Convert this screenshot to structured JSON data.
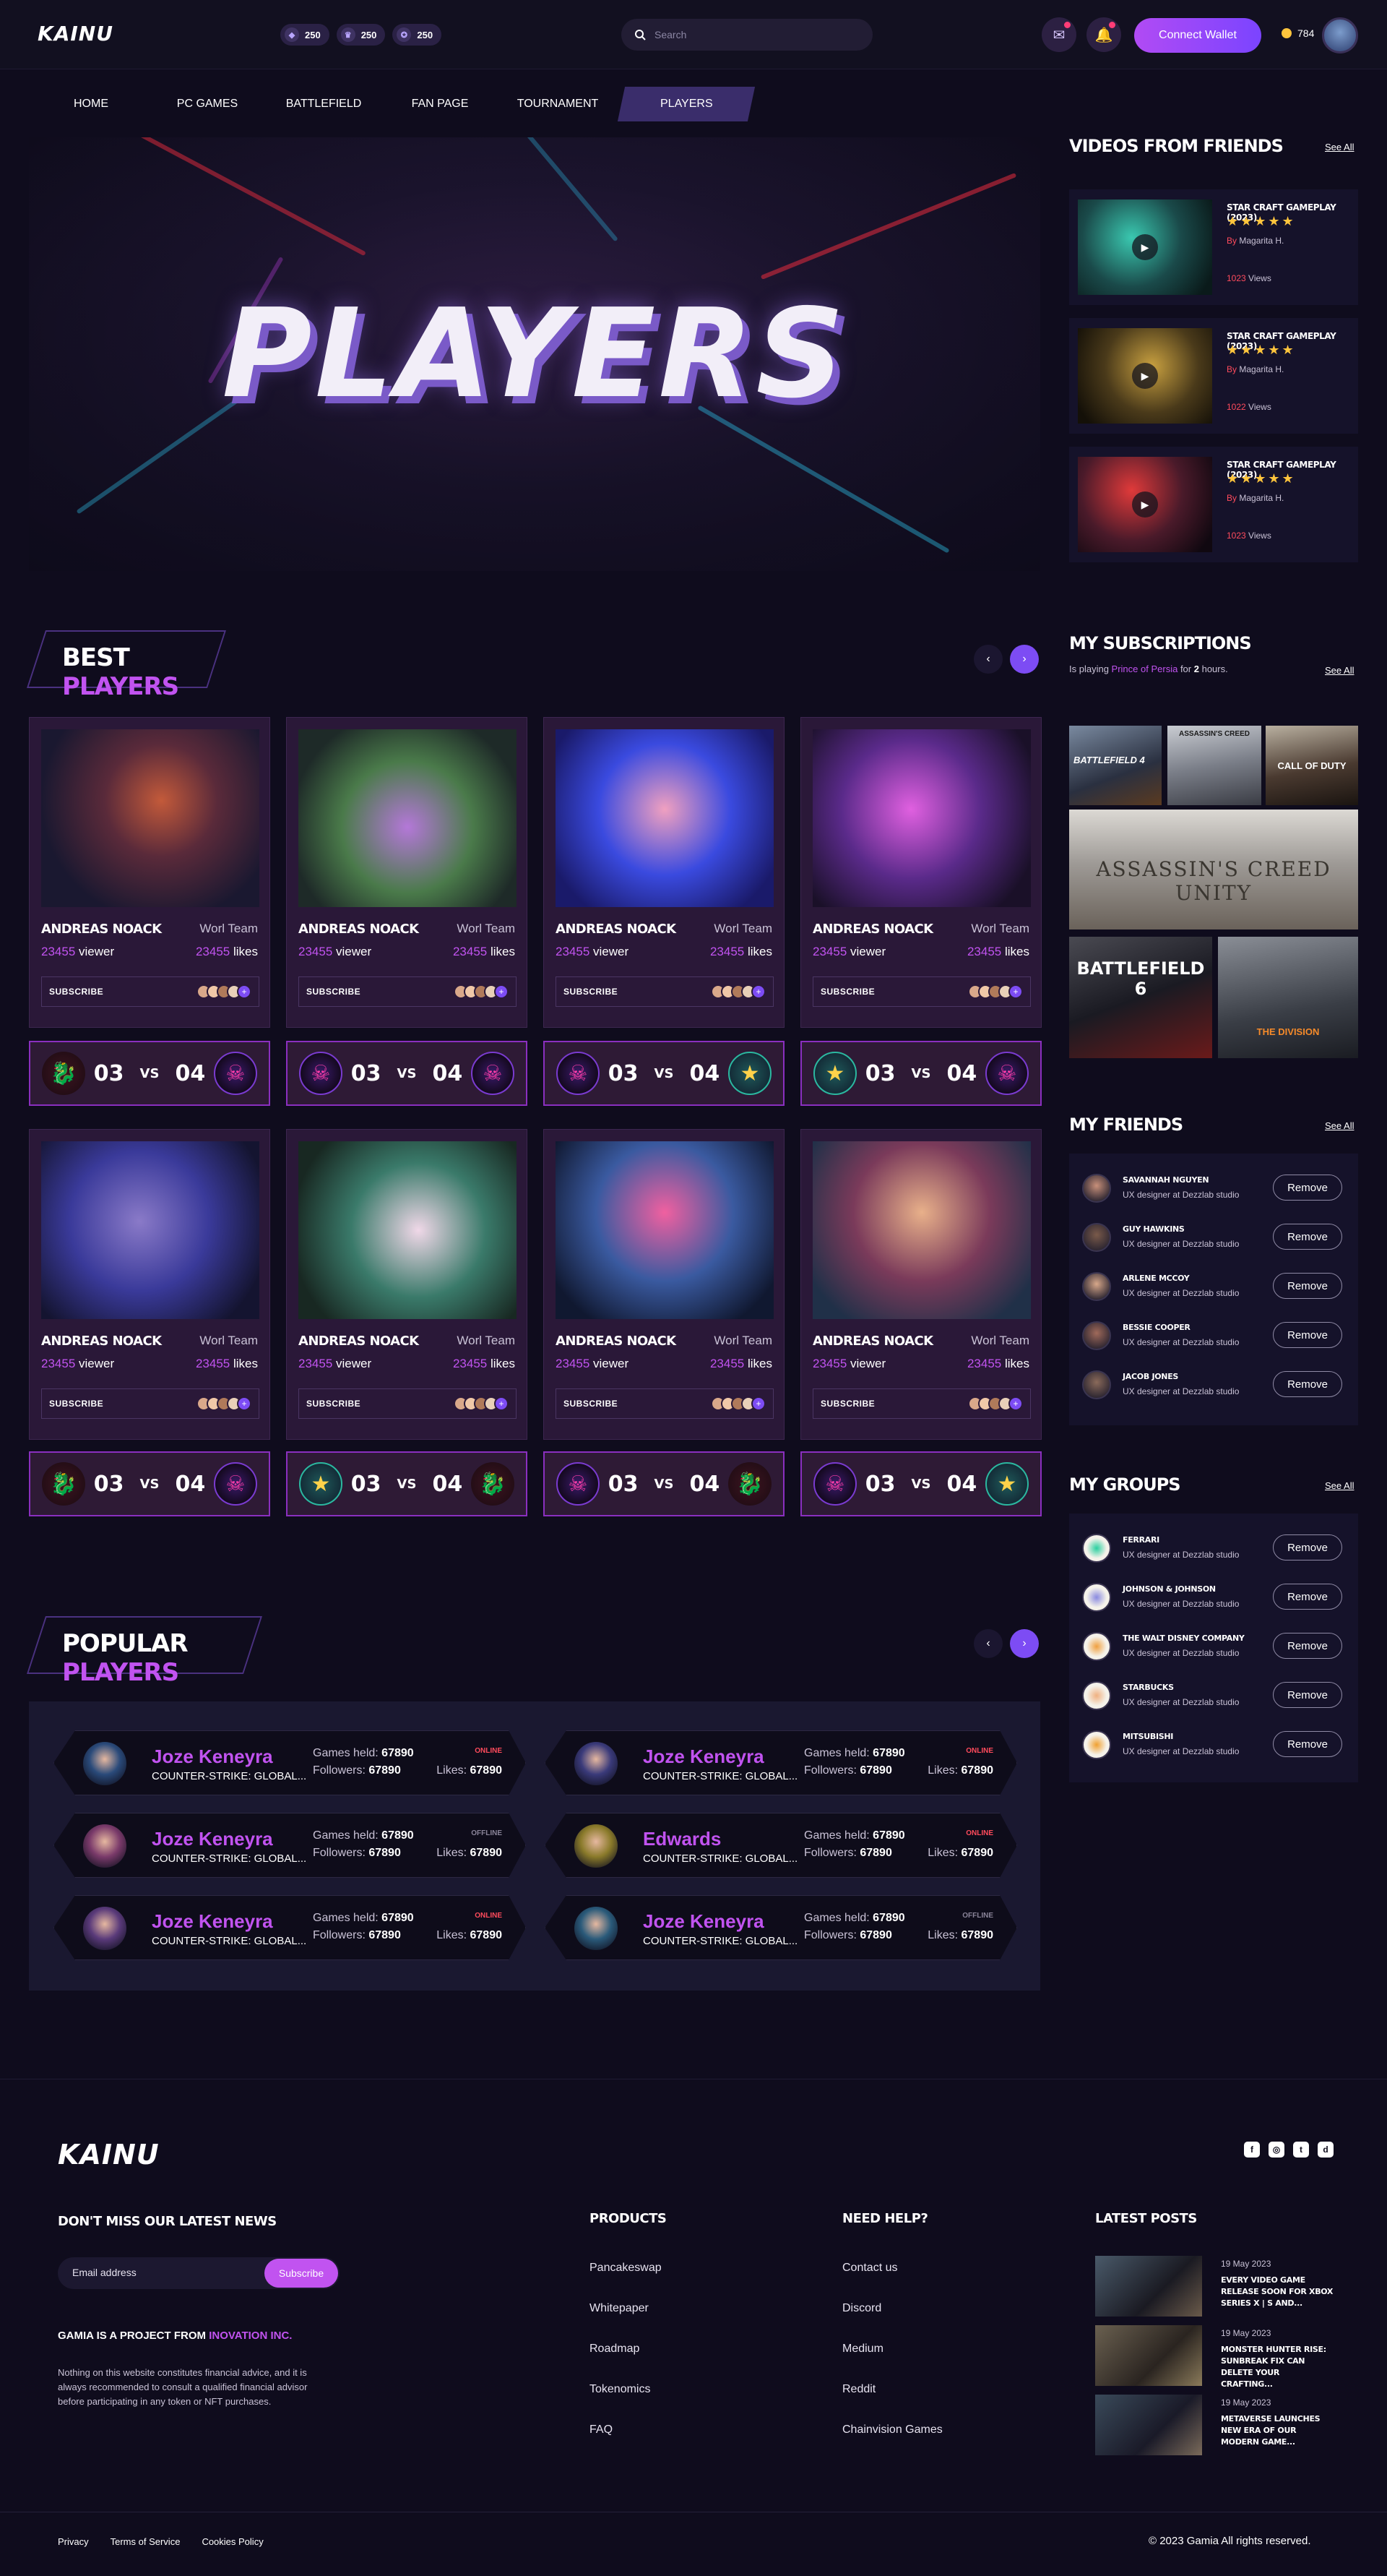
{
  "header": {
    "logo": "KAINU",
    "stats": [
      {
        "icon": "controller-icon",
        "value": "250"
      },
      {
        "icon": "trophy-icon",
        "value": "250"
      },
      {
        "icon": "medal-icon",
        "value": "250"
      }
    ],
    "search_placeholder": "Search",
    "connect_label": "Connect Wallet",
    "coins": "784"
  },
  "nav": [
    "HOME",
    "PC GAMES",
    "BATTLEFIELD",
    "FAN PAGE",
    "TOURNAMENT",
    "PLAYERS"
  ],
  "hero": {
    "title": "PLAYERS"
  },
  "best_players": {
    "title_plain": "BEST",
    "title_accent": "PLAYERS",
    "cards": [
      {
        "name": "ANDREAS NOACK",
        "team": "Worl Team",
        "viewer_num": "23455",
        "viewer_label": "viewer",
        "likes_num": "23455",
        "likes_label": "likes",
        "subscribe": "SUBSCRIBE",
        "score_a": "03",
        "vs": "VS",
        "score_b": "04"
      },
      {
        "name": "ANDREAS NOACK",
        "team": "Worl Team",
        "viewer_num": "23455",
        "viewer_label": "viewer",
        "likes_num": "23455",
        "likes_label": "likes",
        "subscribe": "SUBSCRIBE",
        "score_a": "03",
        "vs": "VS",
        "score_b": "04"
      },
      {
        "name": "ANDREAS NOACK",
        "team": "Worl Team",
        "viewer_num": "23455",
        "viewer_label": "viewer",
        "likes_num": "23455",
        "likes_label": "likes",
        "subscribe": "SUBSCRIBE",
        "score_a": "03",
        "vs": "VS",
        "score_b": "04"
      },
      {
        "name": "ANDREAS NOACK",
        "team": "Worl Team",
        "viewer_num": "23455",
        "viewer_label": "viewer",
        "likes_num": "23455",
        "likes_label": "likes",
        "subscribe": "SUBSCRIBE",
        "score_a": "03",
        "vs": "VS",
        "score_b": "04"
      },
      {
        "name": "ANDREAS NOACK",
        "team": "Worl Team",
        "viewer_num": "23455",
        "viewer_label": "viewer",
        "likes_num": "23455",
        "likes_label": "likes",
        "subscribe": "SUBSCRIBE",
        "score_a": "03",
        "vs": "VS",
        "score_b": "04"
      },
      {
        "name": "ANDREAS NOACK",
        "team": "Worl Team",
        "viewer_num": "23455",
        "viewer_label": "viewer",
        "likes_num": "23455",
        "likes_label": "likes",
        "subscribe": "SUBSCRIBE",
        "score_a": "03",
        "vs": "VS",
        "score_b": "04"
      },
      {
        "name": "ANDREAS NOACK",
        "team": "Worl Team",
        "viewer_num": "23455",
        "viewer_label": "viewer",
        "likes_num": "23455",
        "likes_label": "likes",
        "subscribe": "SUBSCRIBE",
        "score_a": "03",
        "vs": "VS",
        "score_b": "04"
      },
      {
        "name": "ANDREAS NOACK",
        "team": "Worl Team",
        "viewer_num": "23455",
        "viewer_label": "viewer",
        "likes_num": "23455",
        "likes_label": "likes",
        "subscribe": "SUBSCRIBE",
        "score_a": "03",
        "vs": "VS",
        "score_b": "04"
      }
    ]
  },
  "popular_players": {
    "title_plain": "POPULAR",
    "title_accent": "PLAYERS",
    "games_held_label": "Games held:",
    "followers_label": "Followers:",
    "likes_label": "Likes:",
    "items": [
      {
        "name": "Joze Keneyra",
        "game": "COUNTER-STRIKE: GLOBAL...",
        "games_held": "67890",
        "followers": "67890",
        "likes": "67890",
        "status": "ONLINE"
      },
      {
        "name": "Joze Keneyra",
        "game": "COUNTER-STRIKE: GLOBAL...",
        "games_held": "67890",
        "followers": "67890",
        "likes": "67890",
        "status": "ONLINE"
      },
      {
        "name": "Joze Keneyra",
        "game": "COUNTER-STRIKE: GLOBAL...",
        "games_held": "67890",
        "followers": "67890",
        "likes": "67890",
        "status": "OFFLINE"
      },
      {
        "name": "Edwards",
        "game": "COUNTER-STRIKE: GLOBAL...",
        "games_held": "67890",
        "followers": "67890",
        "likes": "67890",
        "status": "ONLINE"
      },
      {
        "name": "Joze Keneyra",
        "game": "COUNTER-STRIKE: GLOBAL...",
        "games_held": "67890",
        "followers": "67890",
        "likes": "67890",
        "status": "ONLINE"
      },
      {
        "name": "Joze Keneyra",
        "game": "COUNTER-STRIKE: GLOBAL...",
        "games_held": "67890",
        "followers": "67890",
        "likes": "67890",
        "status": "OFFLINE"
      }
    ]
  },
  "videos": {
    "title": "VIDEOS FROM FRIENDS",
    "see_all": "See All",
    "items": [
      {
        "title": "STAR CRAFT GAMEPLAY (2023)",
        "stars": "★★★★★",
        "by": "By",
        "author": "Magarita H.",
        "views_num": "1023",
        "views_label": "Views"
      },
      {
        "title": "STAR CRAFT GAMEPLAY (2023)",
        "stars": "★★★★★",
        "by": "By",
        "author": "Magarita H.",
        "views_num": "1022",
        "views_label": "Views"
      },
      {
        "title": "STAR CRAFT GAMEPLAY (2023)",
        "stars": "★★★★★",
        "by": "By",
        "author": "Magarita H.",
        "views_num": "1023",
        "views_label": "Views"
      }
    ]
  },
  "subscriptions": {
    "title": "MY SUBSCRIPTIONS",
    "playing_prefix": "Is playing",
    "playing_game": "Prince of Persia",
    "playing_for": "for",
    "playing_hours": "2",
    "playing_suffix": "hours.",
    "see_all": "See All",
    "tiles": [
      "BATTLEFIELD 4",
      "ASSASSIN'S CREED",
      "CALL OF DUTY",
      "ASSASSIN'S CREED UNITY",
      "BATTLEFIELD 6",
      "THE DIVISION"
    ]
  },
  "friends": {
    "title": "MY FRIENDS",
    "see_all": "See All",
    "remove": "Remove",
    "items": [
      {
        "name": "SAVANNAH NGUYEN",
        "role": "UX designer at Dezzlab studio"
      },
      {
        "name": "GUY HAWKINS",
        "role": "UX designer at Dezzlab studio"
      },
      {
        "name": "ARLENE MCCOY",
        "role": "UX designer at Dezzlab studio"
      },
      {
        "name": "BESSIE COOPER",
        "role": "UX designer at Dezzlab studio"
      },
      {
        "name": "JACOB JONES",
        "role": "UX designer at Dezzlab studio"
      }
    ]
  },
  "groups": {
    "title": "MY GROUPS",
    "see_all": "See All",
    "remove": "Remove",
    "items": [
      {
        "name": "FERRARI",
        "role": "UX designer at Dezzlab studio"
      },
      {
        "name": "JOHNSON & JOHNSON",
        "role": "UX designer at Dezzlab studio"
      },
      {
        "name": "THE WALT DISNEY COMPANY",
        "role": "UX designer at Dezzlab studio"
      },
      {
        "name": "STARBUCKS",
        "role": "UX designer at Dezzlab studio"
      },
      {
        "name": "MITSUBISHI",
        "role": "UX designer at Dezzlab studio"
      }
    ]
  },
  "footer": {
    "logo": "KAINU",
    "newsletter_title": "DON'T MISS OUR LATEST NEWS",
    "email_placeholder": "Email address",
    "subscribe": "Subscribe",
    "project_prefix": "GAMIA IS A PROJECT FROM",
    "project_accent": "INOVATION INC.",
    "disclaimer": "Nothing on this website constitutes financial advice, and it is always recommended to consult a qualified financial advisor before participating in any token or NFT purchases.",
    "products_title": "PRODUCTS",
    "products": [
      "Pancakeswap",
      "Whitepaper",
      "Roadmap",
      "Tokenomics",
      "FAQ"
    ],
    "help_title": "NEED HELP?",
    "help": [
      "Contact us",
      "Discord",
      "Medium",
      "Reddit",
      "Chainvision Games"
    ],
    "posts_title": "LATEST POSTS",
    "posts": [
      {
        "date": "19 May 2023",
        "title": "EVERY VIDEO GAME RELEASE SOON FOR XBOX SERIES X | S AND..."
      },
      {
        "date": "19 May 2023",
        "title": "MONSTER HUNTER RISE: SUNBREAK FIX CAN DELETE YOUR CRAFTING..."
      },
      {
        "date": "19 May 2023",
        "title": "METAVERSE LAUNCHES NEW ERA OF OUR MODERN GAME..."
      }
    ],
    "bottom_links": [
      "Privacy",
      "Terms of Service",
      "Cookies Policy"
    ],
    "copyright": "© 2023 Gamia All rights reserved."
  },
  "colors": {
    "accent": "#c153f0",
    "button": "#7d4cf4",
    "online": "#ff4b5c",
    "background": "#0f0c1d"
  }
}
